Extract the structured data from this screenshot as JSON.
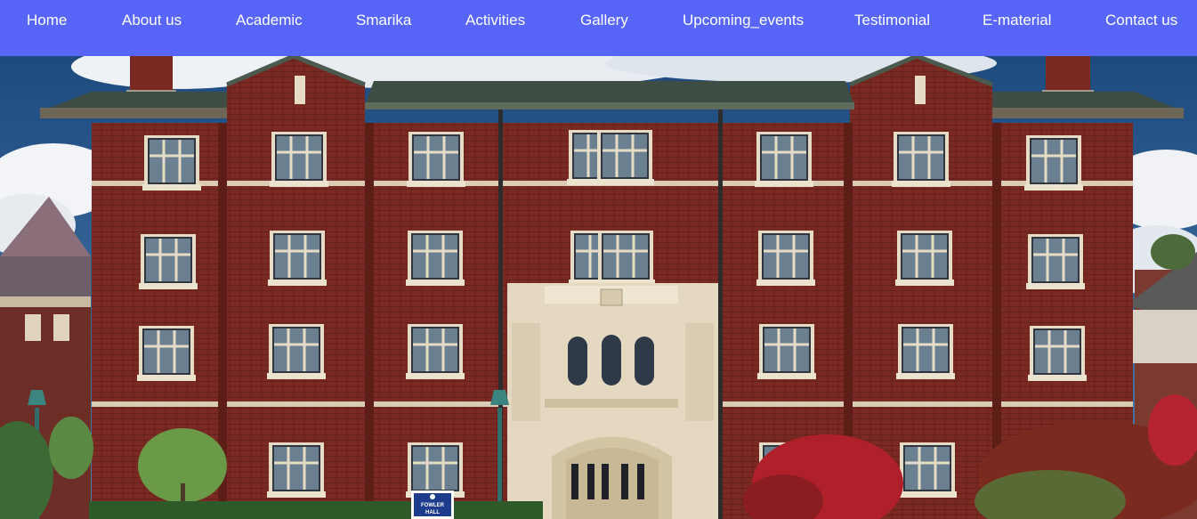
{
  "nav": {
    "items": [
      {
        "label": "Home"
      },
      {
        "label": "About us"
      },
      {
        "label": "Academic"
      },
      {
        "label": "Smarika"
      },
      {
        "label": "Activities"
      },
      {
        "label": "Gallery"
      },
      {
        "label": "Upcoming_events"
      },
      {
        "label": "Testimonial"
      },
      {
        "label": "E-material"
      },
      {
        "label": "Contact us"
      }
    ]
  },
  "hero": {
    "sign_line1": "FOWLER",
    "sign_line2": "HALL"
  },
  "colors": {
    "nav_background": "#5766f8",
    "nav_text": "#ffffff",
    "brick": "#7a2a22",
    "trim": "#e8dcc4",
    "roof": "#4a5a4e",
    "sky": "#2d5a8c"
  }
}
